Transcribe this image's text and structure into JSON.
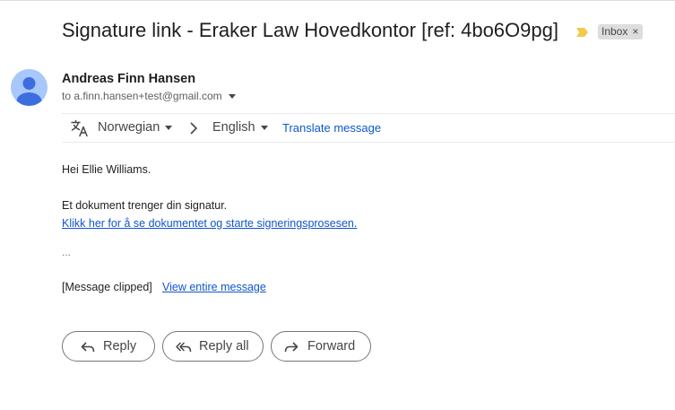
{
  "email": {
    "subject": "Signature link - Eraker Law Hovedkontor [ref: 4bo6O9pg]",
    "label_badge": "Inbox",
    "label_badge_close": "×",
    "sender_name": "Andreas Finn Hansen",
    "recipient_line": "to a.finn.hansen+test@gmail.com"
  },
  "translate": {
    "source_language": "Norwegian",
    "target_language": "English",
    "translate_link": "Translate message"
  },
  "body": {
    "greeting": "Hei Ellie Williams.",
    "line1": "Et dokument trenger din signatur.",
    "link": "Klikk her for å se dokumentet og starte signeringsprosesen.",
    "ellipsis": "...",
    "clipped_label": "[Message clipped]",
    "view_entire": "View entire message"
  },
  "actions": {
    "reply": "Reply",
    "reply_all": "Reply all",
    "forward": "Forward"
  },
  "colors": {
    "accent_link": "#0b57d0",
    "importance_marker": "#f2c94c",
    "avatar_bg": "#a8c7fa",
    "avatar_fg": "#3c6ee0"
  },
  "icons": {
    "importance": "importance-marker-icon",
    "avatar": "default-avatar-icon",
    "translate": "translate-icon",
    "reply": "reply-arrow-icon",
    "reply_all": "reply-all-arrow-icon",
    "forward": "forward-arrow-icon"
  }
}
